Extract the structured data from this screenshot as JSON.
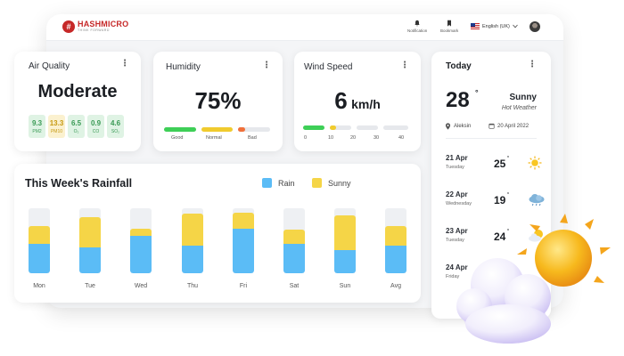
{
  "topbar": {
    "logo_mark": "#",
    "logo_name": "HASHMICRO",
    "logo_tag": "THINK FORWARD",
    "notification_label": "Notification",
    "bookmark_label": "Bookmark",
    "language": "English (UK)"
  },
  "air_quality": {
    "title": "Air Quality",
    "status": "Moderate",
    "metrics": [
      {
        "value": "9.3",
        "unit": "PM2",
        "bg": "#dff3e4",
        "fg": "#3a9a55"
      },
      {
        "value": "13.3",
        "unit": "PM10",
        "bg": "#fbf1cf",
        "fg": "#c79a12"
      },
      {
        "value": "6.5",
        "unit": "O₂",
        "bg": "#dff3e4",
        "fg": "#3a9a55"
      },
      {
        "value": "0.9",
        "unit": "CO",
        "bg": "#dff3e4",
        "fg": "#3a9a55"
      },
      {
        "value": "4.6",
        "unit": "SO₂",
        "bg": "#dff3e4",
        "fg": "#3a9a55"
      }
    ]
  },
  "humidity": {
    "title": "Humidity",
    "value": "75%",
    "labels": [
      "Good",
      "Normal",
      "Bad"
    ],
    "colors": {
      "good": "#3ecf57",
      "normal": "#f0cb2e",
      "bad": "#f0703a",
      "track": "#e6e8ec"
    }
  },
  "wind": {
    "title": "Wind Speed",
    "value": "6",
    "unit": "km/h",
    "ticks": [
      "0",
      "10",
      "20",
      "30",
      "40"
    ],
    "colors": {
      "low": "#3ecf57",
      "mid": "#f0cb2e",
      "track": "#e6e8ec"
    }
  },
  "rainfall": {
    "title": "This Week's Rainfall",
    "legend_rain": "Rain",
    "legend_sunny": "Sunny",
    "colors": {
      "rain": "#5bbcf6",
      "sunny": "#f5d547",
      "track": "#eef0f3"
    }
  },
  "chart_data": {
    "type": "bar",
    "categories": [
      "Mon",
      "Tue",
      "Wed",
      "Thu",
      "Fri",
      "Sat",
      "Sun",
      "Avg"
    ],
    "series": [
      {
        "name": "Rain",
        "values": [
          45,
          40,
          58,
          42,
          68,
          45,
          35,
          43
        ]
      },
      {
        "name": "Sunny",
        "values": [
          28,
          46,
          10,
          50,
          25,
          22,
          54,
          30
        ]
      }
    ],
    "ylim": [
      0,
      100
    ],
    "stacked": true,
    "grid": false,
    "legend": "top"
  },
  "today": {
    "title": "Today",
    "temp": "28",
    "deg": "°",
    "condition": "Sunny",
    "sub": "Hot Weather",
    "location": "Aleksin",
    "date": "20 April 2022",
    "forecast": [
      {
        "date": "21 Apr",
        "day": "Tuesday",
        "temp": "25",
        "icon": "sun-icon"
      },
      {
        "date": "22 Apr",
        "day": "Wednesday",
        "temp": "19",
        "icon": "rain-cloud-icon"
      },
      {
        "date": "23 Apr",
        "day": "Tuesday",
        "temp": "24",
        "icon": "partly-cloudy-icon"
      },
      {
        "date": "24 Apr",
        "day": "Friday",
        "temp": "",
        "icon": ""
      }
    ]
  }
}
